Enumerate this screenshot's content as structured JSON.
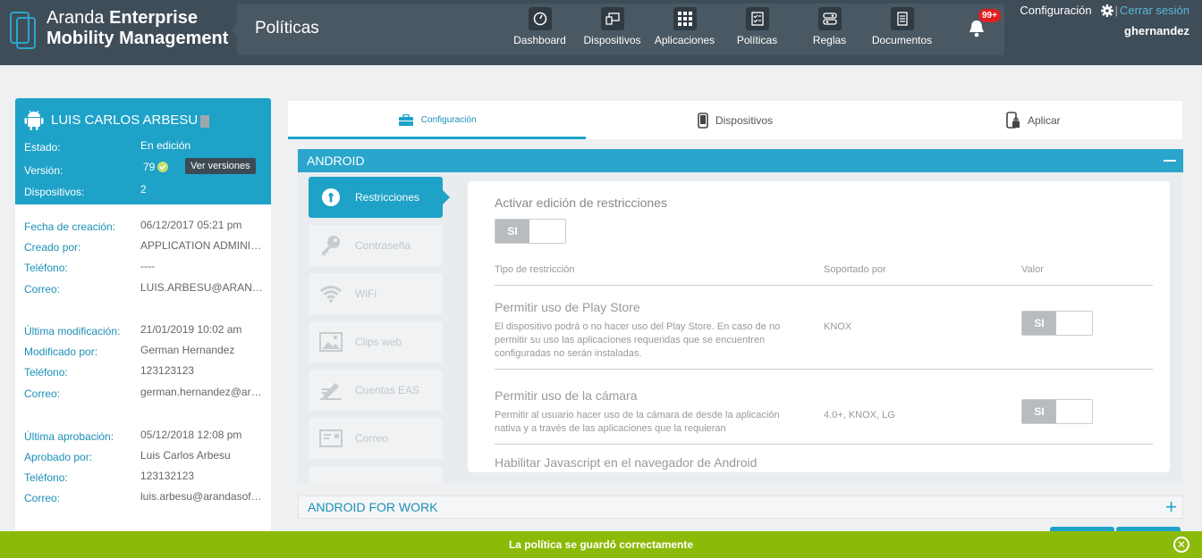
{
  "brand": {
    "line1_light": "Aranda ",
    "line1_bold": "Enterprise",
    "line2": "Mobility Management"
  },
  "section_title": "Políticas",
  "nav": [
    {
      "label": "Dashboard",
      "icon": "dashboard-icon"
    },
    {
      "label": "Dispositivos",
      "icon": "devices-icon"
    },
    {
      "label": "Aplicaciones",
      "icon": "apps-grid-icon"
    },
    {
      "label": "Políticas",
      "icon": "checklist-icon"
    },
    {
      "label": "Reglas",
      "icon": "rules-icon"
    },
    {
      "label": "Documentos",
      "icon": "document-icon"
    }
  ],
  "notifications": {
    "badge": "99+"
  },
  "top_right": {
    "config": "Configuración",
    "separator": "|",
    "logout": "Cerrar sesión",
    "user": "ghernandez"
  },
  "device": {
    "name": "LUIS CARLOS ARBESU",
    "estado_label": "Estado:",
    "estado": "En edición",
    "version_label": "Versión:",
    "version": "79",
    "ver_versiones": "Ver versiones",
    "dispositivos_label": "Dispositivos:",
    "dispositivos": "2"
  },
  "info": {
    "creacion": [
      {
        "label": "Fecha de creación:",
        "value": "06/12/2017 05:21 pm"
      },
      {
        "label": "Creado por:",
        "value": "APPLICATION ADMINIST..."
      },
      {
        "label": "Teléfono:",
        "value": "----"
      },
      {
        "label": "Correo:",
        "value": "LUIS.ARBESU@ARANDA..."
      }
    ],
    "modificacion": [
      {
        "label": "Última modificación:",
        "value": "21/01/2019 10:02 am"
      },
      {
        "label": "Modificado por:",
        "value": "German Hernandez"
      },
      {
        "label": "Teléfono:",
        "value": "123123123"
      },
      {
        "label": "Correo:",
        "value": "german.hernandez@ara..."
      }
    ],
    "aprobacion": [
      {
        "label": "Última aprobación:",
        "value": "05/12/2018 12:08 pm"
      },
      {
        "label": "Aprobado por:",
        "value": "Luis Carlos Arbesu"
      },
      {
        "label": "Teléfono:",
        "value": "123132123"
      },
      {
        "label": "Correo:",
        "value": "luis.arbesu@arandasoft...."
      }
    ]
  },
  "tabs": [
    {
      "label": "Configuración",
      "icon": "briefcase-icon",
      "active": true
    },
    {
      "label": "Dispositivos",
      "icon": "phone-icon"
    },
    {
      "label": "Aplicar",
      "icon": "lock-phone-icon"
    }
  ],
  "android": {
    "header": "ANDROID",
    "menu": [
      {
        "label": "Restricciones",
        "icon": "keyhole-icon",
        "active": true
      },
      {
        "label": "Contraseña",
        "icon": "key-icon"
      },
      {
        "label": "WiFi",
        "icon": "wifi-icon"
      },
      {
        "label": "Clips web",
        "icon": "image-icon"
      },
      {
        "label": "Cuentas EAS",
        "icon": "sign-icon"
      },
      {
        "label": "Correo",
        "icon": "mail-icon"
      }
    ],
    "content": {
      "title": "Activar edición de restricciones",
      "toggle": "SI",
      "columns": {
        "tipo": "Tipo de restricción",
        "soportado": "Soportado por",
        "valor": "Valor"
      },
      "rows": [
        {
          "title": "Permitir uso de Play Store",
          "desc": "El dispositivo podrá o no hacer uso del Play Store. En caso de no permitir su uso las aplicaciones requeridas que se encuentren configuradas no serán instaladas.",
          "supported": "KNOX",
          "value": "SI"
        },
        {
          "title": "Permitir uso de la cámara",
          "desc": "Permitir al usuario hacer uso de la cámara de desde la aplicación nativa y a través de las aplicaciones que la requieran",
          "supported": "4.0+, KNOX, LG",
          "value": "SI"
        },
        {
          "title": "Habilitar Javascript en el navegador de Android"
        }
      ]
    }
  },
  "android_work": {
    "header": "ANDROID FOR WORK"
  },
  "toast": {
    "message": "La política se guardó correctamente"
  },
  "colors": {
    "topbar": "#3f4d58",
    "accent": "#1ea2c8",
    "toast": "#8cba08"
  }
}
